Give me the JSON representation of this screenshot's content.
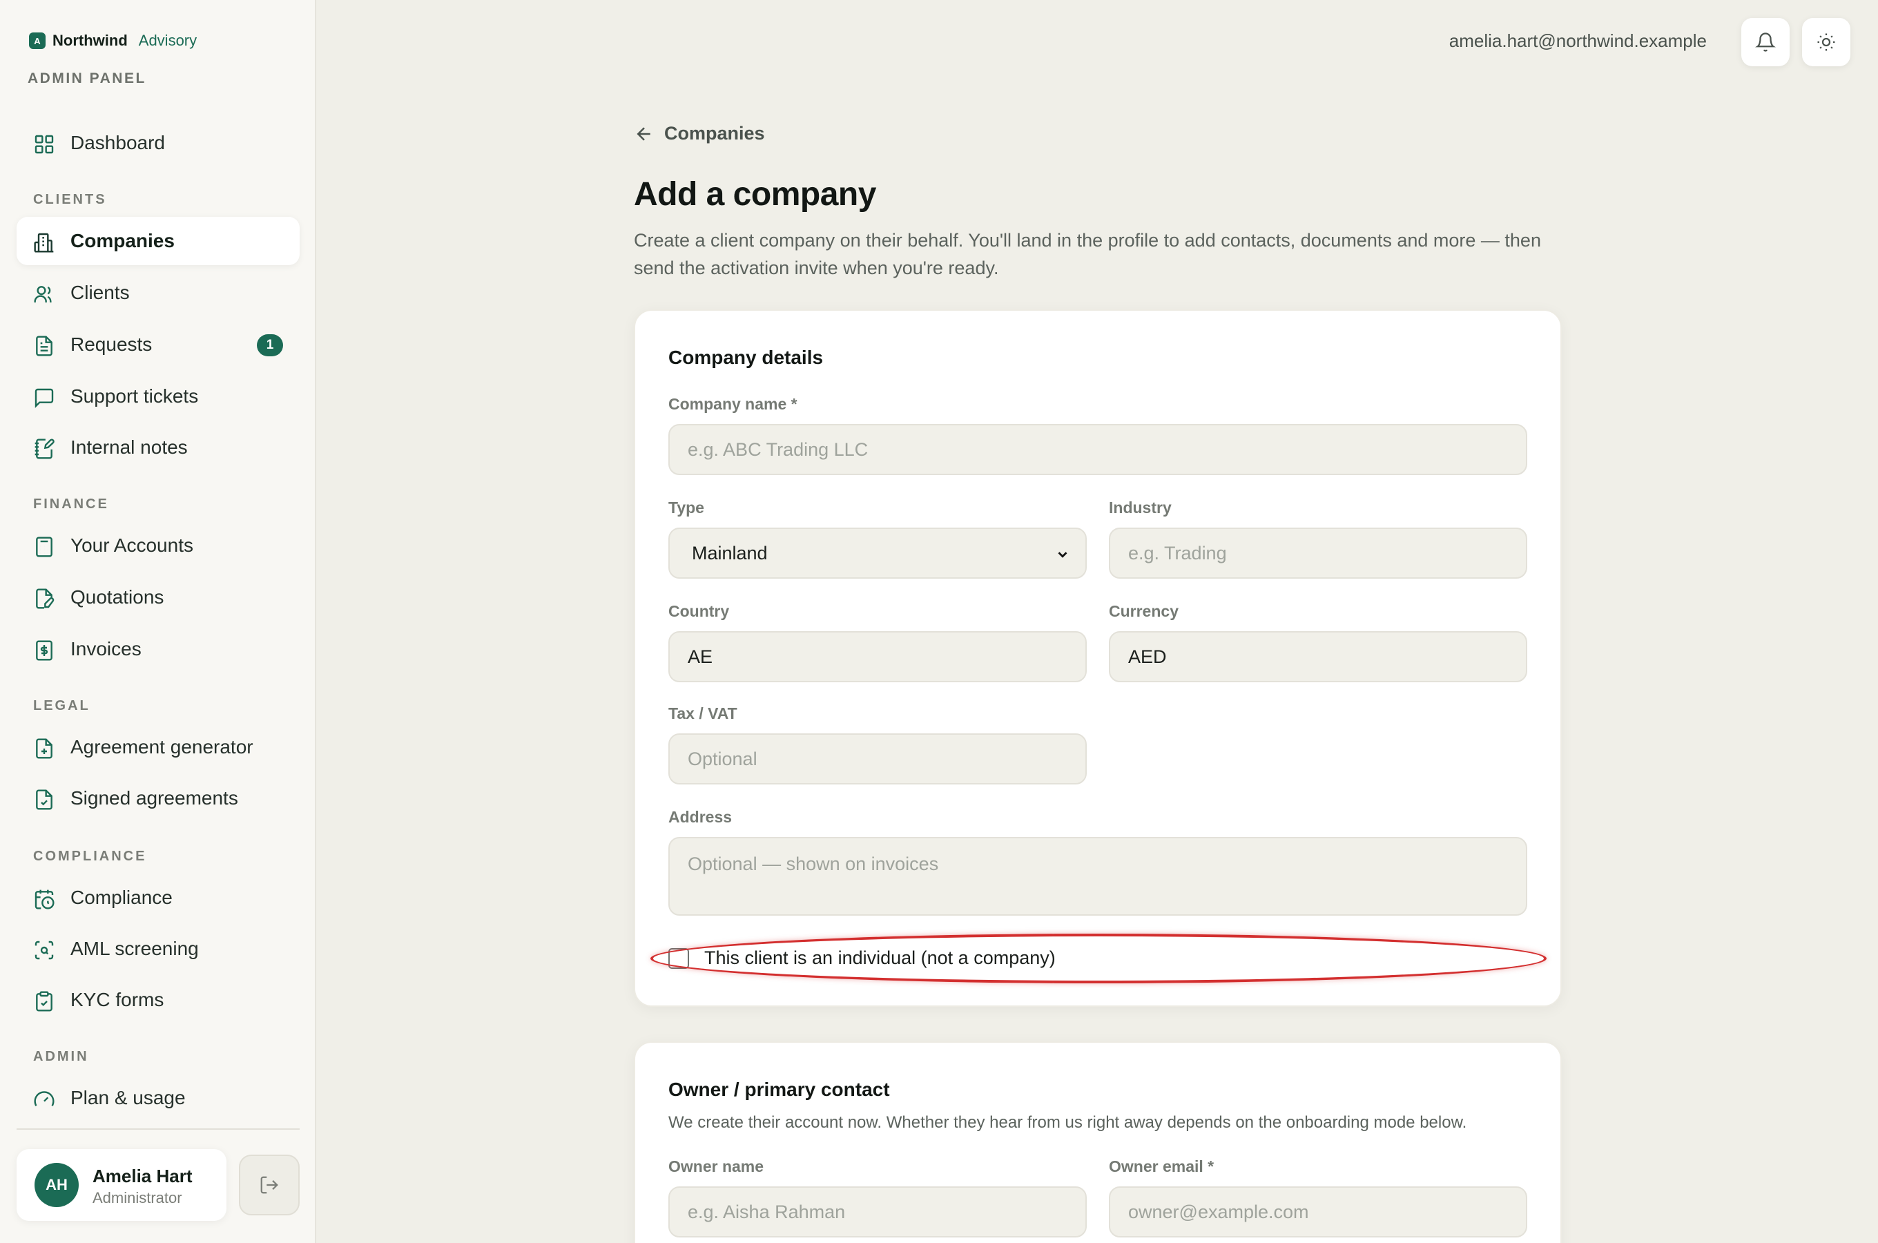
{
  "brand": {
    "logo_letter": "A",
    "name": "Northwind",
    "sub": "Advisory",
    "panel_label": "ADMIN PANEL"
  },
  "sidebar": {
    "dashboard": {
      "label": "Dashboard",
      "icon": "grid-icon"
    },
    "sections": [
      {
        "label": "CLIENTS",
        "items": [
          {
            "label": "Companies",
            "icon": "building-icon",
            "active": true
          },
          {
            "label": "Clients",
            "icon": "users-icon"
          },
          {
            "label": "Requests",
            "icon": "document-icon",
            "badge": "1"
          },
          {
            "label": "Support tickets",
            "icon": "chat-icon"
          },
          {
            "label": "Internal notes",
            "icon": "note-edit-icon"
          }
        ]
      },
      {
        "label": "FINANCE",
        "items": [
          {
            "label": "Your Accounts",
            "icon": "calculator-icon"
          },
          {
            "label": "Quotations",
            "icon": "file-edit-icon"
          },
          {
            "label": "Invoices",
            "icon": "dollar-file-icon"
          }
        ]
      },
      {
        "label": "LEGAL",
        "items": [
          {
            "label": "Agreement generator",
            "icon": "file-plus-icon"
          },
          {
            "label": "Signed agreements",
            "icon": "file-check-icon"
          }
        ]
      },
      {
        "label": "COMPLIANCE",
        "items": [
          {
            "label": "Compliance",
            "icon": "calendar-clock-icon"
          },
          {
            "label": "AML screening",
            "icon": "scan-search-icon"
          },
          {
            "label": "KYC forms",
            "icon": "clipboard-icon"
          }
        ]
      },
      {
        "label": "ADMIN",
        "items": [
          {
            "label": "Plan & usage",
            "icon": "gauge-icon"
          }
        ]
      }
    ]
  },
  "user": {
    "initials": "AH",
    "name": "Amelia Hart",
    "role": "Administrator"
  },
  "topbar": {
    "email": "amelia.hart@northwind.example"
  },
  "page": {
    "back_label": "Companies",
    "title": "Add a company",
    "description": "Create a client company on their behalf. You'll land in the profile to add contacts, documents and more — then send the activation invite when you're ready."
  },
  "company_details": {
    "title": "Company details",
    "company_name": {
      "label": "Company name *",
      "placeholder": "e.g. ABC Trading LLC"
    },
    "type": {
      "label": "Type",
      "value": "Mainland"
    },
    "industry": {
      "label": "Industry",
      "placeholder": "e.g. Trading"
    },
    "country": {
      "label": "Country",
      "value": "AE"
    },
    "currency": {
      "label": "Currency",
      "value": "AED"
    },
    "tax": {
      "label": "Tax / VAT",
      "placeholder": "Optional"
    },
    "address": {
      "label": "Address",
      "placeholder": "Optional — shown on invoices"
    },
    "individual_checkbox": {
      "label": "This client is an individual (not a company)",
      "checked": false
    }
  },
  "owner_contact": {
    "title": "Owner / primary contact",
    "subtitle": "We create their account now. Whether they hear from us right away depends on the onboarding mode below.",
    "owner_name": {
      "label": "Owner name",
      "placeholder": "e.g. Aisha Rahman"
    },
    "owner_email": {
      "label": "Owner email *",
      "placeholder": "owner@example.com"
    }
  },
  "colors": {
    "accent": "#1b6b55",
    "annotation": "#d32f2f",
    "background": "#f0efe8"
  }
}
